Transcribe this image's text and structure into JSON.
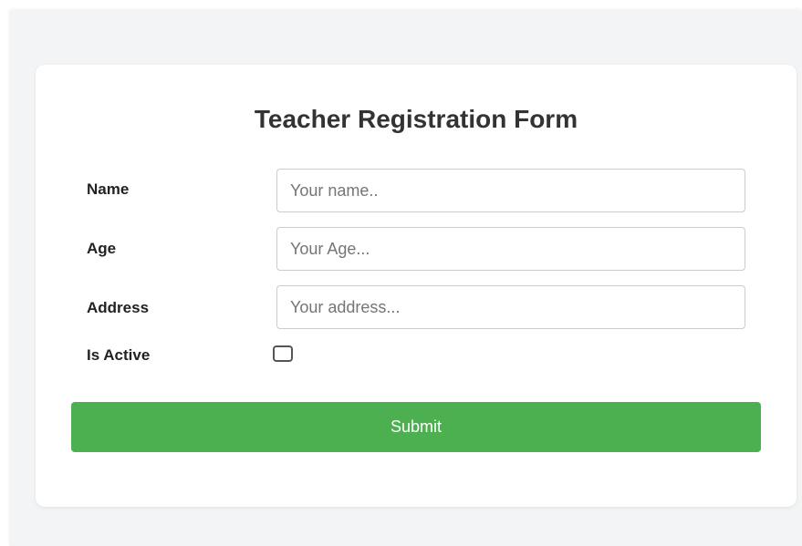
{
  "form": {
    "title": "Teacher Registration Form",
    "fields": {
      "name": {
        "label": "Name",
        "placeholder": "Your name..",
        "value": ""
      },
      "age": {
        "label": "Age",
        "placeholder": "Your Age...",
        "value": ""
      },
      "address": {
        "label": "Address",
        "placeholder": "Your address...",
        "value": ""
      }
    },
    "is_active": {
      "label": "Is Active",
      "checked": false
    },
    "submit_label": "Submit"
  },
  "colors": {
    "background": "#f2f4f6",
    "card": "#ffffff",
    "submit": "#4caf50",
    "text": "#333333"
  }
}
